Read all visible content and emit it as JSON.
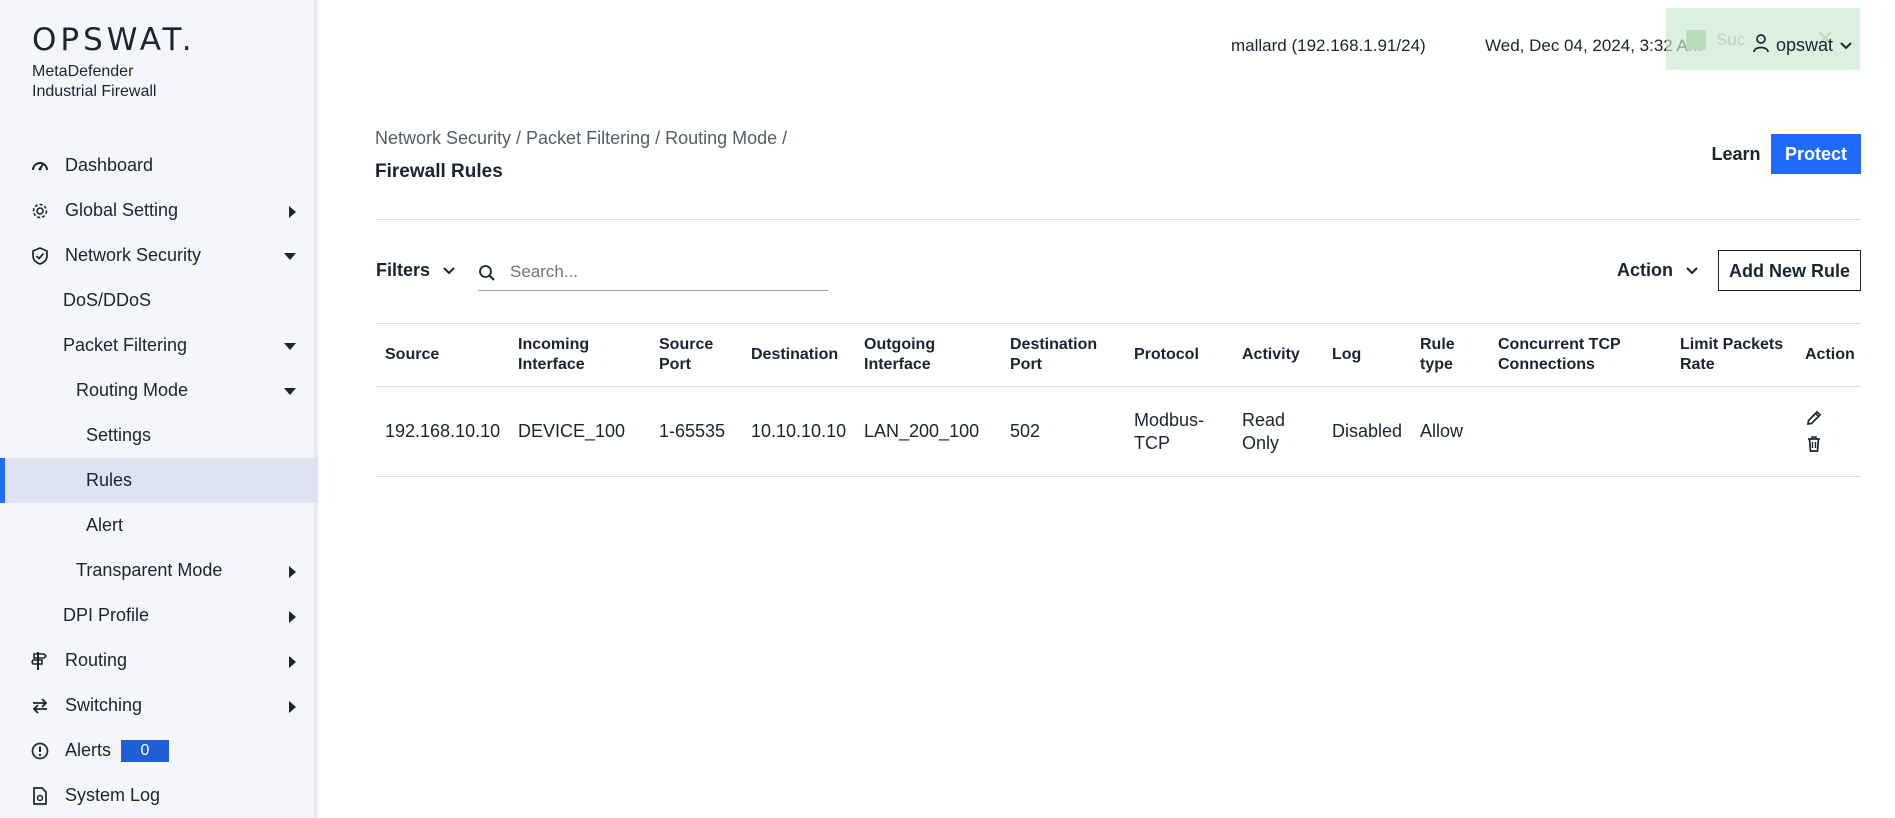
{
  "brand": {
    "logo_text": "OPSWAT.",
    "product_line1": "MetaDefender",
    "product_line2": "Industrial Firewall"
  },
  "sidebar": {
    "items": [
      {
        "label": "Dashboard",
        "icon": "gauge-icon"
      },
      {
        "label": "Global Setting",
        "icon": "gear-icon"
      },
      {
        "label": "Network Security",
        "icon": "shield-check-icon"
      },
      {
        "label": "DoS/DDoS"
      },
      {
        "label": "Packet Filtering"
      },
      {
        "label": "Routing Mode"
      },
      {
        "label": "Settings"
      },
      {
        "label": "Rules"
      },
      {
        "label": "Alert"
      },
      {
        "label": "Transparent Mode"
      },
      {
        "label": "DPI Profile"
      },
      {
        "label": "Routing",
        "icon": "signpost-icon"
      },
      {
        "label": "Switching",
        "icon": "swap-arrows-icon"
      },
      {
        "label": "Alerts",
        "icon": "alert-circle-icon",
        "badge": "0"
      },
      {
        "label": "System Log",
        "icon": "document-icon"
      }
    ]
  },
  "header": {
    "host": "mallard (192.168.1.91/24)",
    "datetime": "Wed, Dec 04, 2024, 3:32 AM",
    "toast_text": "Suc",
    "user": "opswat"
  },
  "breadcrumb": "Network Security / Packet Filtering / Routing Mode /",
  "page_title": "Firewall Rules",
  "buttons": {
    "learn": "Learn",
    "protect": "Protect",
    "filters": "Filters",
    "action": "Action",
    "add_rule": "Add New Rule"
  },
  "search": {
    "placeholder": "Search...",
    "value": ""
  },
  "table": {
    "headers": [
      "Source",
      "Incoming Interface",
      "Source Port",
      "Destination",
      "Outgoing Interface",
      "Destination Port",
      "Protocol",
      "Activity",
      "Log",
      "Rule type",
      "Concurrent TCP Connections",
      "Limit Packets Rate",
      "Action"
    ],
    "rows": [
      [
        "192.168.10.10",
        "DEVICE_100",
        "1-65535",
        "10.10.10.10",
        "LAN_200_100",
        "502",
        "Modbus-TCP",
        "Read Only",
        "Disabled",
        "Allow",
        "",
        ""
      ]
    ]
  },
  "colors": {
    "accent": "#1f6bff",
    "badge": "#1f5fd6",
    "sidebar_bg": "#f4f6fa",
    "active_bg": "#dde3f0"
  }
}
